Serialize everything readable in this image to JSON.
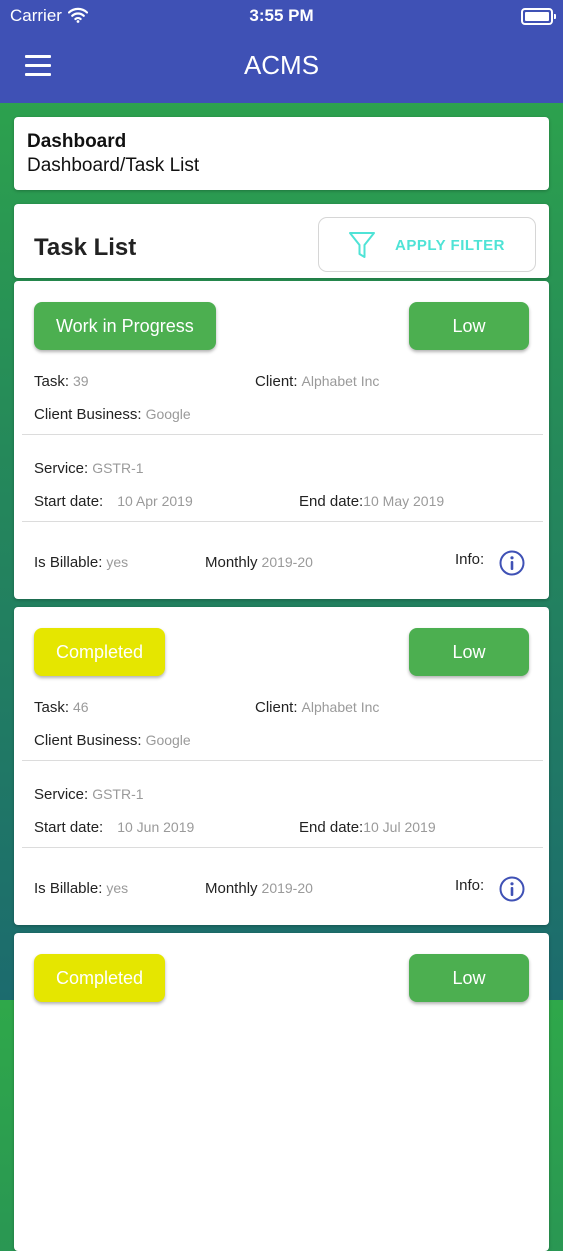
{
  "status_bar": {
    "carrier": "Carrier",
    "time": "3:55 PM"
  },
  "app_bar": {
    "title": "ACMS",
    "menu_icon": "hamburger-menu-icon"
  },
  "breadcrumb": {
    "title": "Dashboard",
    "path": "Dashboard/Task List"
  },
  "task_list": {
    "title": "Task List",
    "filter_label": "APPLY FILTER",
    "filter_icon": "funnel-icon"
  },
  "labels": {
    "task": "Task:",
    "client": "Client:",
    "client_business": "Client Business:",
    "service": "Service:",
    "start_date": "Start date:",
    "end_date": "End date:",
    "is_billable": "Is Billable:",
    "monthly": "Monthly",
    "info": "Info:"
  },
  "colors": {
    "app_bar": "#3f51b5",
    "work_in_progress": "#4caf50",
    "completed": "#e5e600",
    "priority_low": "#4caf50",
    "filter_accent": "#4fe3d6",
    "info_icon": "#3f51b5"
  },
  "tasks": [
    {
      "status": "Work in Progress",
      "priority": "Low",
      "task": "39",
      "client": "Alphabet Inc",
      "client_business": "Google",
      "service": "GSTR-1",
      "start_date": "10 Apr 2019",
      "end_date": "10 May 2019",
      "is_billable": "yes",
      "monthly": "2019-20"
    },
    {
      "status": "Completed",
      "priority": "Low",
      "task": "46",
      "client": "Alphabet Inc",
      "client_business": "Google",
      "service": "GSTR-1",
      "start_date": "10 Jun 2019",
      "end_date": "10 Jul 2019",
      "is_billable": "yes",
      "monthly": "2019-20"
    },
    {
      "status": "Completed",
      "priority": "Low"
    }
  ]
}
